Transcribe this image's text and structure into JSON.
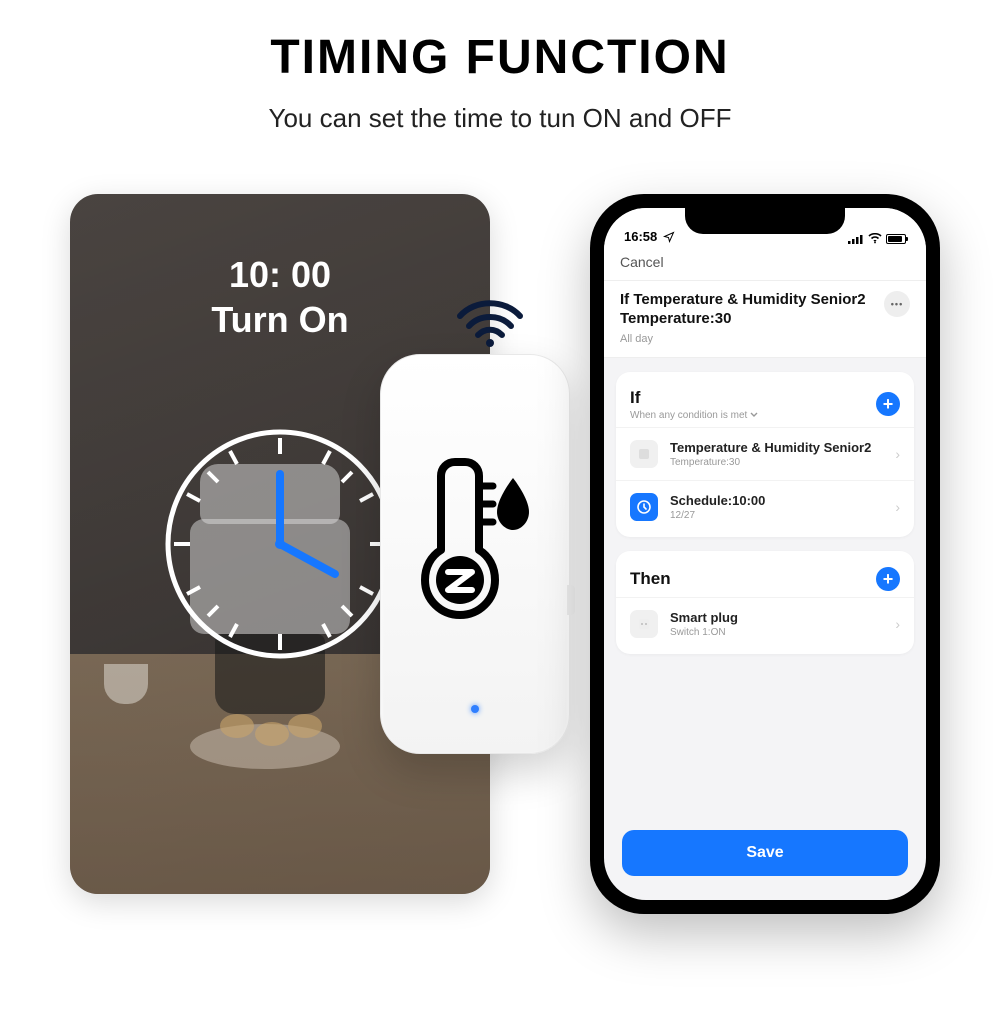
{
  "heading": {
    "title": "TIMING FUNCTION",
    "subtitle": "You can set the time to tun ON and OFF"
  },
  "kitchen": {
    "time": "10: 00",
    "action": "Turn On"
  },
  "icons": {
    "wifi": "wifi-icon",
    "thermometer": "thermometer-humidity-icon",
    "clock": "clock-icon"
  },
  "phone": {
    "status": {
      "time": "16:58"
    },
    "nav": {
      "cancel": "Cancel"
    },
    "rule": {
      "title_line1": "If Temperature & Humidity Senior2",
      "title_line2": "Temperature:30",
      "subtitle": "All day"
    },
    "if_section": {
      "title": "If",
      "subtitle": "When any condition is met",
      "rows": [
        {
          "title": "Temperature & Humidity Senior2",
          "sub": "Temperature:30",
          "icon": "sensor"
        },
        {
          "title": "Schedule:10:00",
          "sub": "12/27",
          "icon": "clock"
        }
      ]
    },
    "then_section": {
      "title": "Then",
      "rows": [
        {
          "title": "Smart plug",
          "sub": "Switch 1:ON",
          "icon": "plug"
        }
      ]
    },
    "save": "Save"
  },
  "colors": {
    "accent": "#1677ff"
  }
}
